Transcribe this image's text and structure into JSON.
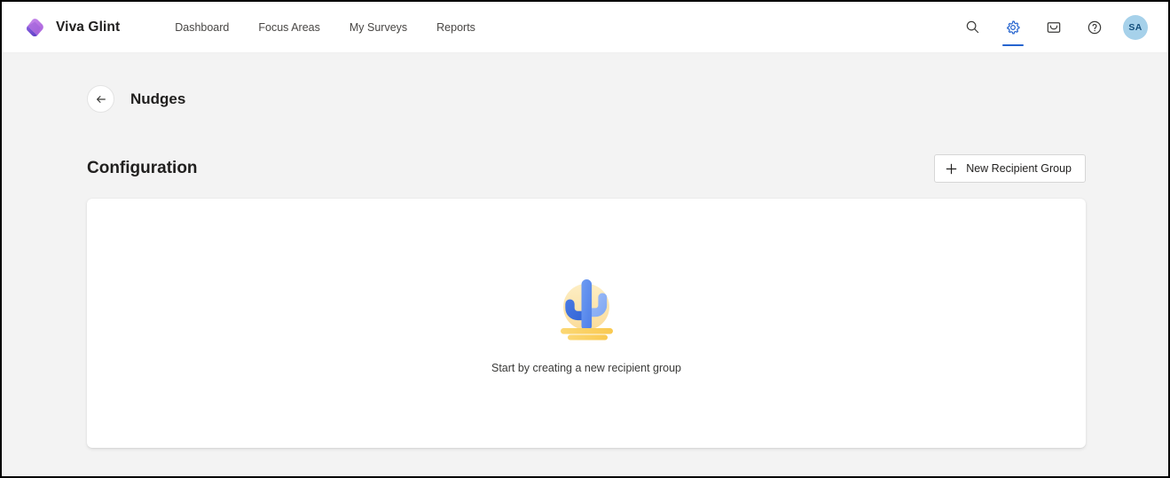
{
  "header": {
    "brand_name": "Viva Glint",
    "logo_icon": "viva-glint-rhombus-logo",
    "nav": [
      {
        "label": "Dashboard",
        "name": "dashboard"
      },
      {
        "label": "Focus Areas",
        "name": "focus-areas"
      },
      {
        "label": "My Surveys",
        "name": "my-surveys"
      },
      {
        "label": "Reports",
        "name": "reports"
      }
    ],
    "actions": [
      {
        "icon": "search-icon",
        "active": false
      },
      {
        "icon": "gear-icon",
        "active": true
      },
      {
        "icon": "inbox-icon",
        "active": false
      },
      {
        "icon": "help-icon",
        "active": false
      }
    ],
    "avatar_initials": "SA"
  },
  "page": {
    "back_icon": "arrow-left-icon",
    "title": "Nudges",
    "section_title": "Configuration",
    "new_group_button": {
      "label": "New Recipient Group",
      "icon": "plus-icon"
    },
    "empty_state": {
      "illustration": "cactus-desert-illustration",
      "message": "Start by creating a new recipient group"
    }
  },
  "colors": {
    "accent_blue": "#2564cf",
    "brand_purple": "#b46ae0",
    "brand_purple_dark": "#6b4ad0",
    "avatar_bg": "#a6d1ea",
    "page_bg": "#f3f3f3",
    "card_bg": "#ffffff",
    "cactus_blue": "#5b8def",
    "cactus_blue_light": "#7ba7f5",
    "sun_yellow": "#fce5b0",
    "ground_yellow": "#fbd163"
  }
}
